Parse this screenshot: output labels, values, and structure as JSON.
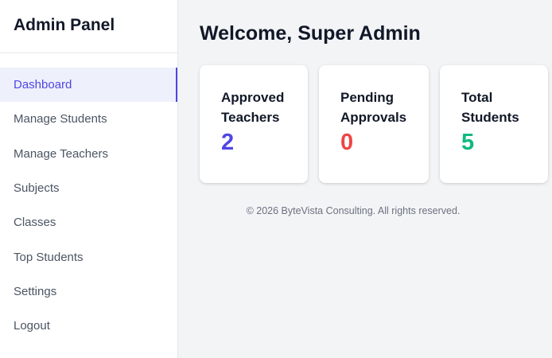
{
  "sidebar": {
    "title": "Admin Panel",
    "items": [
      {
        "label": "Dashboard"
      },
      {
        "label": "Manage Students"
      },
      {
        "label": "Manage Teachers"
      },
      {
        "label": "Subjects"
      },
      {
        "label": "Classes"
      },
      {
        "label": "Top Students"
      },
      {
        "label": "Settings"
      },
      {
        "label": "Logout"
      }
    ]
  },
  "main": {
    "welcome": "Welcome, Super Admin",
    "cards": [
      {
        "line1": "Approved",
        "line2": "Teachers",
        "value": "2",
        "color": "#4f46e5"
      },
      {
        "line1": "Pending",
        "line2": "Approvals",
        "value": "0",
        "color": "#ef4444"
      },
      {
        "line1": "Total",
        "line2": "Students",
        "value": "5",
        "color": "#10b981"
      }
    ],
    "footer": "© 2026 ByteVista Consulting. All rights reserved."
  },
  "colors": {
    "accent": "#4f46e5",
    "danger": "#ef4444",
    "success": "#10b981"
  }
}
